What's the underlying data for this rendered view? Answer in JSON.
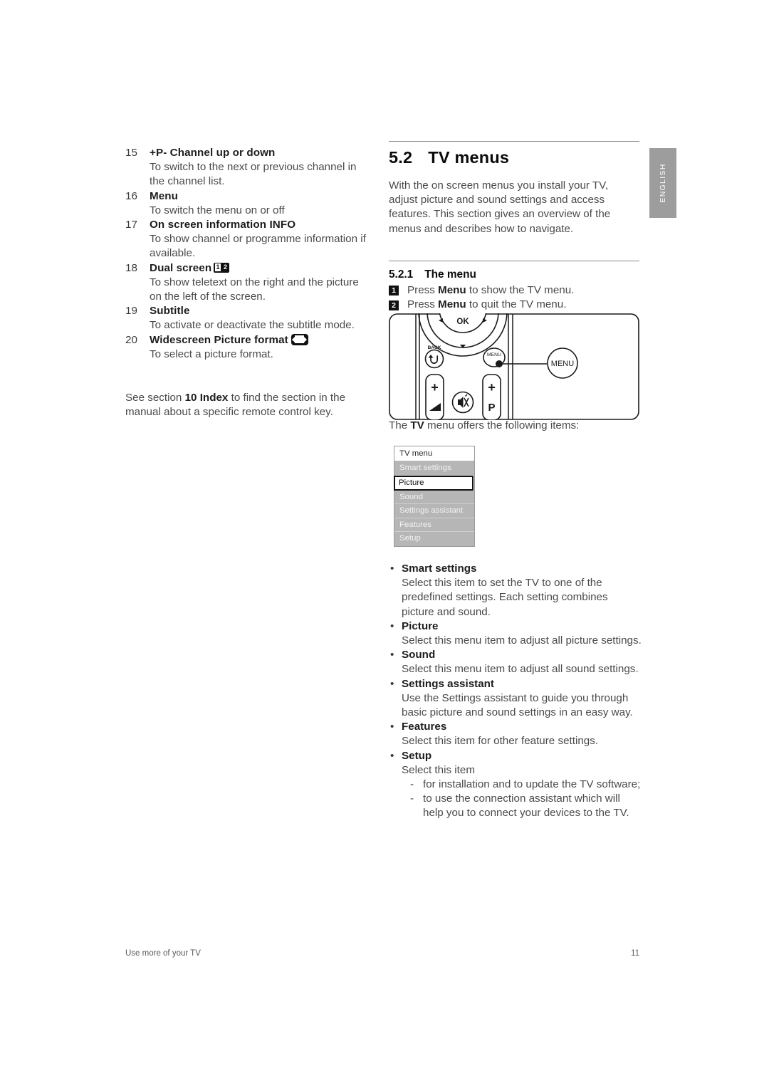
{
  "document": {
    "footer_left": "Use more of your TV",
    "page_number": "11",
    "side_tab": "ENGLISH"
  },
  "left_column": {
    "items": [
      {
        "num": "15",
        "term": "+P-  Channel up or down",
        "desc": "To switch to the next or previous channel in the channel list.",
        "icon": null
      },
      {
        "num": "16",
        "term": "Menu",
        "desc": "To switch the menu on or off",
        "icon": null
      },
      {
        "num": "17",
        "term": "On screen information INFO",
        "desc": "To show channel or programme information if available.",
        "icon": null
      },
      {
        "num": "18",
        "term": "Dual screen",
        "desc": "To show teletext on the right and the picture on the left of the screen.",
        "icon": "dual-screen-icon"
      },
      {
        "num": "19",
        "term": "Subtitle",
        "desc": "To activate or deactivate the subtitle mode.",
        "icon": null
      },
      {
        "num": "20",
        "term": "Widescreen Picture format",
        "desc": "To select a picture format.",
        "icon": "widescreen-format-icon"
      }
    ],
    "see_section": {
      "before": "See section ",
      "bold": "10 Index",
      "after": " to find the section in the manual about a specific remote control key."
    }
  },
  "right_column": {
    "section": {
      "number": "5.2",
      "title": "TV menus"
    },
    "intro": "With the on screen menus you install your TV, adjust picture and sound settings and access features. This section gives an overview of the menus and describes how to navigate.",
    "subsection": {
      "number": "5.2.1",
      "title": "The menu"
    },
    "steps": [
      {
        "badge": "1",
        "before": "Press ",
        "bold": "Menu",
        "after": " to show the TV menu."
      },
      {
        "badge": "2",
        "before": "Press ",
        "bold": "Menu",
        "after": " to quit the TV menu."
      }
    ],
    "offers_line": {
      "before": "The ",
      "bold": "TV",
      "after": " menu offers the following items:"
    }
  },
  "remote_figure": {
    "ok_label": "OK",
    "back_label": "BACK",
    "menu_label": "MENU",
    "callout_label": "MENU",
    "volume_plus": "+",
    "programme_plus": "+",
    "programme_letter": "P",
    "left_arrow": "◀",
    "right_arrow": "▶",
    "down_arrow": "▼"
  },
  "tv_menu_box": {
    "header": "TV menu",
    "rows": [
      {
        "label": "Smart settings",
        "state": "normal"
      },
      {
        "label": "Picture",
        "state": "selected"
      },
      {
        "label": "Sound",
        "state": "normal"
      },
      {
        "label": "Settings assistant",
        "state": "normal"
      },
      {
        "label": "Features",
        "state": "normal"
      },
      {
        "label": "Setup",
        "state": "normal"
      }
    ]
  },
  "menu_descriptions": [
    {
      "title": "Smart settings",
      "body": "Select this item to set the TV to one of the predefined settings. Each setting combines picture and sound.",
      "sub": []
    },
    {
      "title": "Picture",
      "body": "Select this menu item to adjust all picture settings.",
      "sub": []
    },
    {
      "title": "Sound",
      "body": "Select this menu item to adjust all sound settings.",
      "sub": []
    },
    {
      "title": "Settings assistant",
      "body": "Use the Settings assistant to guide you through basic picture and sound settings in an easy way.",
      "sub": []
    },
    {
      "title": "Features",
      "body": "Select this item for other feature settings.",
      "sub": []
    },
    {
      "title": "Setup",
      "body": "Select this item",
      "sub": [
        "for installation and to update the TV software;",
        "to use the connection assistant which will help you to connect your devices to the TV."
      ]
    }
  ],
  "colors": {
    "tab_gray": "#9d9d9d",
    "menu_row_gray": "#b6b6b6",
    "rule": "#8a8a8a",
    "body_text": "#4a4a4a",
    "heading_text": "#0a0a0a"
  }
}
